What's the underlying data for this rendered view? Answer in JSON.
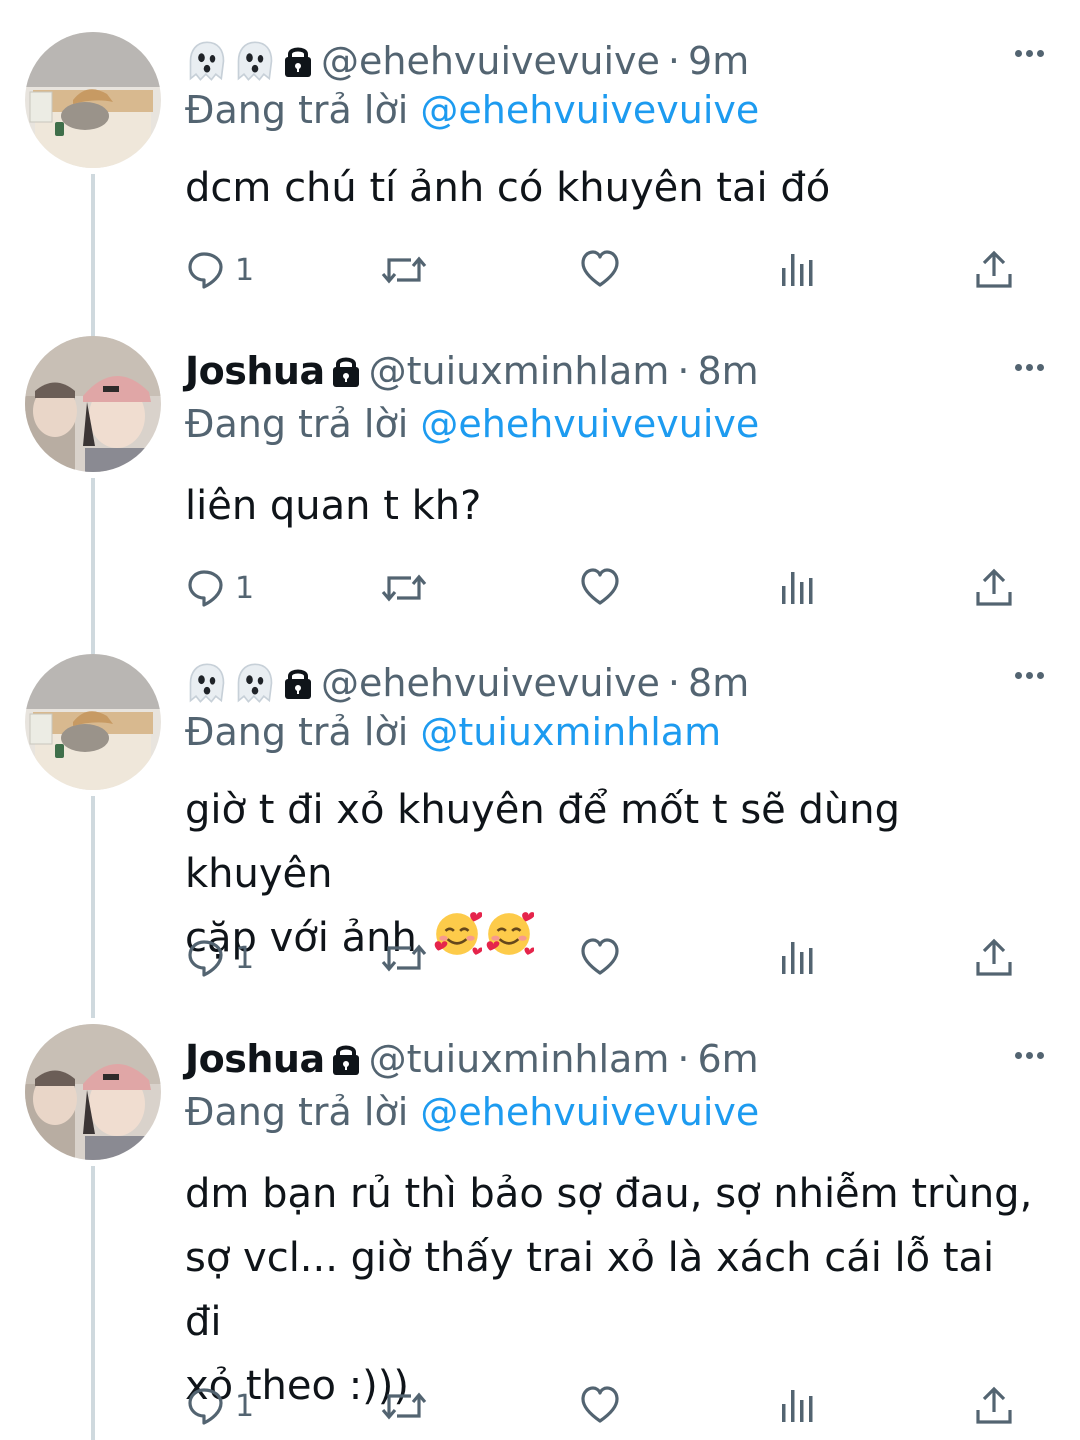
{
  "tweets": [
    {
      "display_name": "",
      "name_emoji": [
        "ghost-icon",
        "ghost-icon"
      ],
      "locked": true,
      "handle": "@ehehvuivevuive",
      "separator": "·",
      "time": "9m",
      "replying_prefix": "Đang trả lời",
      "replying_to": "@ehehvuivevuive",
      "text": "dcm chú tí ảnh có khuyên tai đó",
      "reply_count": "1"
    },
    {
      "display_name": "Joshua",
      "name_emoji": [],
      "locked": true,
      "handle": "@tuiuxminhlam",
      "separator": "·",
      "time": "8m",
      "replying_prefix": "Đang trả lời",
      "replying_to": "@ehehvuivevuive",
      "text": "liên quan t kh?",
      "reply_count": "1"
    },
    {
      "display_name": "",
      "name_emoji": [
        "ghost-icon",
        "ghost-icon"
      ],
      "locked": true,
      "handle": "@ehehvuivevuive",
      "separator": "·",
      "time": "8m",
      "replying_prefix": "Đang trả lời",
      "replying_to": "@tuiuxminhlam",
      "text_line1": "giờ t đi xỏ khuyên để mốt t sẽ dùng khuyên",
      "text_line2": "cặp với ảnh",
      "text_emoji": [
        "smiling-face-with-hearts-icon",
        "smiling-face-with-hearts-icon"
      ],
      "reply_count": "1"
    },
    {
      "display_name": "Joshua",
      "name_emoji": [],
      "locked": true,
      "handle": "@tuiuxminhlam",
      "separator": "·",
      "time": "6m",
      "replying_prefix": "Đang trả lời",
      "replying_to": "@ehehvuivevuive",
      "text_line1": "dm bạn rủ thì bảo sợ đau, sợ nhiễm trùng,",
      "text_line2": "sợ vcl... giờ thấy trai xỏ là xách cái lỗ tai đi",
      "text_line3": "xỏ theo :)))",
      "reply_count": "1"
    }
  ],
  "colors": {
    "text": "#0f1419",
    "secondary": "#536471",
    "mention": "#1d9bf0",
    "thread_line": "#cfd9de"
  }
}
